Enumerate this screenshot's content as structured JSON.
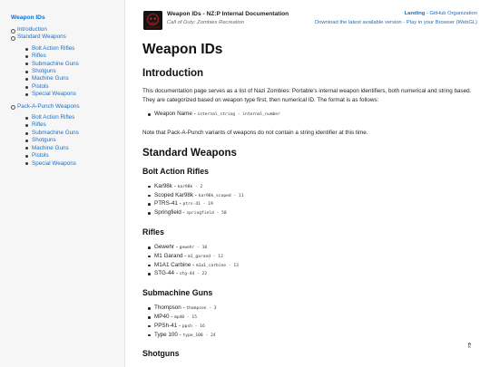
{
  "sidebar": {
    "title": "Weapon IDs",
    "items": [
      {
        "label": "Introduction",
        "children": []
      },
      {
        "label": "Standard Weapons",
        "children": [
          "Bolt Action Rifles",
          "Rifles",
          "Submachine Guns",
          "Shotguns",
          "Machine Guns",
          "Pistols",
          "Special Weapons"
        ]
      },
      {
        "label": "Pack-A-Punch Weapons",
        "children": [
          "Bolt Action Rifles",
          "Rifles",
          "Submachine Guns",
          "Shotguns",
          "Machine Guns",
          "Pistols",
          "Special Weapons"
        ]
      }
    ]
  },
  "header": {
    "title": "Weapon IDs - NZ:P Internal Documentation",
    "subtitle": "Call of Duty: Zombies Recreation",
    "link_landing": "Landing",
    "link_separator": " - ",
    "link_github": "GitHub Organization",
    "link_download": "Download the latest available version",
    "link_play": "Play in your Browser (WebGL)"
  },
  "main": {
    "page_title": "Weapon IDs",
    "intro_heading": "Introduction",
    "intro_text": "This documentation page serves as a list of Nazi Zombies: Portable's internal weapon identifiers, both numerical and string based. They are categorized based on weapon type first, then numerical ID. The format is as follows:",
    "format_name": "Weapon Name",
    "format_dash": " - ",
    "format_code": "internal_string - internal_number",
    "pap_note": "Note that Pack-A-Punch variants of weapons do not contain a string identifier at this time.",
    "standard_heading": "Standard Weapons",
    "sections": [
      {
        "heading": "Bolt Action Rifles",
        "items": [
          {
            "name": "Kar98k",
            "code": "kar98k - 2"
          },
          {
            "name": "Scoped Kar98k",
            "code": "kar98k_scoped - 11"
          },
          {
            "name": "PTRS-41",
            "code": "ptrs-41 - 19"
          },
          {
            "name": "Springfield",
            "code": "springfield - 58"
          }
        ]
      },
      {
        "heading": "Rifles",
        "items": [
          {
            "name": "Gewehr",
            "code": "gewehr - 10"
          },
          {
            "name": "M1 Garand",
            "code": "m1_garand - 12"
          },
          {
            "name": "M1A1 Carbine",
            "code": "m1a1_carbine - 13"
          },
          {
            "name": "STG-44",
            "code": "stg-44 - 22"
          }
        ]
      },
      {
        "heading": "Submachine Guns",
        "items": [
          {
            "name": "Thompson",
            "code": "thompson - 3"
          },
          {
            "name": "MP40",
            "code": "mp40 - 15"
          },
          {
            "name": "PPSh-41",
            "code": "ppsh - 16"
          },
          {
            "name": "Type 100",
            "code": "type_100 - 24"
          }
        ]
      },
      {
        "heading": "Shotguns",
        "items": []
      }
    ],
    "back_to_top": "⇑"
  }
}
